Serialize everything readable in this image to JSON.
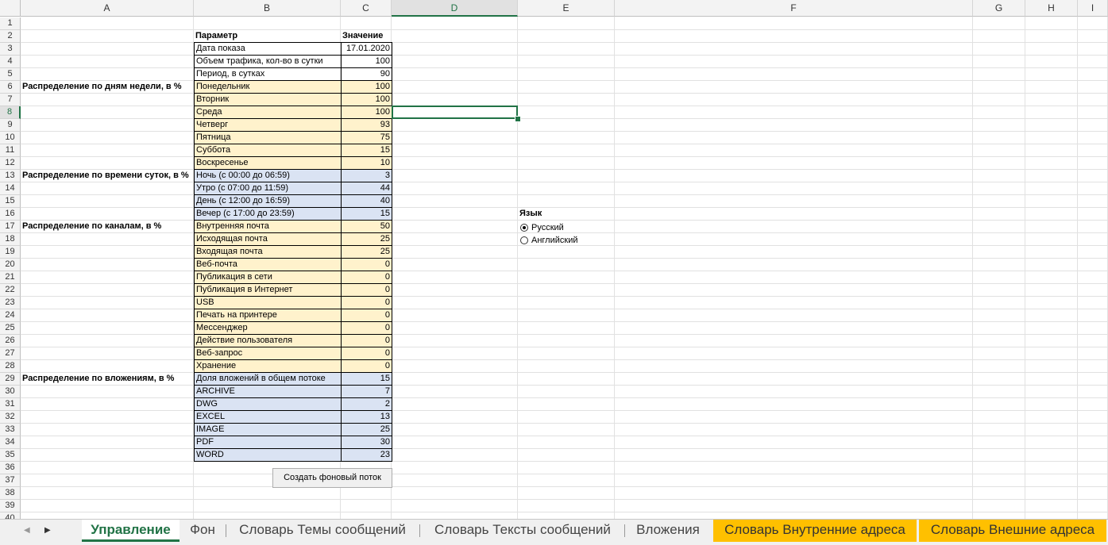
{
  "columns": [
    "A",
    "B",
    "C",
    "D",
    "E",
    "F",
    "G",
    "H",
    "I"
  ],
  "rows": [
    "1",
    "2",
    "3",
    "4",
    "5",
    "6",
    "7",
    "8",
    "9",
    "10",
    "11",
    "12",
    "13",
    "14",
    "15",
    "16",
    "17",
    "18",
    "19",
    "20",
    "21",
    "22",
    "23",
    "24",
    "25",
    "26",
    "27",
    "28",
    "29",
    "30",
    "31",
    "32",
    "33",
    "34",
    "35",
    "36",
    "37",
    "38",
    "39",
    "40"
  ],
  "header": {
    "param": "Параметр",
    "value": "Значение"
  },
  "table": [
    {
      "p": "Дата показа",
      "v": "17.01.2020",
      "fill": "none"
    },
    {
      "p": "Объем трафика, кол-во в сутки",
      "v": "100",
      "fill": "none"
    },
    {
      "p": "Период, в сутках",
      "v": "90",
      "fill": "none"
    },
    {
      "p": "Понедельник",
      "v": "100",
      "fill": "yellow"
    },
    {
      "p": "Вторник",
      "v": "100",
      "fill": "yellow"
    },
    {
      "p": "Среда",
      "v": "100",
      "fill": "yellow"
    },
    {
      "p": "Четверг",
      "v": "93",
      "fill": "yellow"
    },
    {
      "p": "Пятница",
      "v": "75",
      "fill": "yellow"
    },
    {
      "p": "Суббота",
      "v": "15",
      "fill": "yellow"
    },
    {
      "p": "Воскресенье",
      "v": "10",
      "fill": "yellow"
    },
    {
      "p": "Ночь (с 00:00 до 06:59)",
      "v": "3",
      "fill": "blue"
    },
    {
      "p": "Утро (с 07:00 до 11:59)",
      "v": "44",
      "fill": "blue"
    },
    {
      "p": "День (с 12:00 до 16:59)",
      "v": "40",
      "fill": "blue"
    },
    {
      "p": "Вечер (с 17:00 до 23:59)",
      "v": "15",
      "fill": "blue"
    },
    {
      "p": "Внутренняя почта",
      "v": "50",
      "fill": "yellow"
    },
    {
      "p": "Исходящая почта",
      "v": "25",
      "fill": "yellow"
    },
    {
      "p": "Входящая почта",
      "v": "25",
      "fill": "yellow"
    },
    {
      "p": "Веб-почта",
      "v": "0",
      "fill": "yellow"
    },
    {
      "p": "Публикация в сети",
      "v": "0",
      "fill": "yellow"
    },
    {
      "p": "Публикация в Интернет",
      "v": "0",
      "fill": "yellow"
    },
    {
      "p": "USB",
      "v": "0",
      "fill": "yellow"
    },
    {
      "p": "Печать на принтере",
      "v": "0",
      "fill": "yellow"
    },
    {
      "p": "Мессенджер",
      "v": "0",
      "fill": "yellow"
    },
    {
      "p": "Действие пользователя",
      "v": "0",
      "fill": "yellow"
    },
    {
      "p": "Веб-запрос",
      "v": "0",
      "fill": "yellow"
    },
    {
      "p": "Хранение",
      "v": "0",
      "fill": "yellow"
    },
    {
      "p": "Доля вложений в общем потоке",
      "v": "15",
      "fill": "blue"
    },
    {
      "p": "ARCHIVE",
      "v": "7",
      "fill": "blue"
    },
    {
      "p": "DWG",
      "v": "2",
      "fill": "blue"
    },
    {
      "p": "EXCEL",
      "v": "13",
      "fill": "blue"
    },
    {
      "p": "IMAGE",
      "v": "25",
      "fill": "blue"
    },
    {
      "p": "PDF",
      "v": "30",
      "fill": "blue"
    },
    {
      "p": "WORD",
      "v": "23",
      "fill": "blue"
    }
  ],
  "section_labels": {
    "days": "Распределение по дням недели, в %",
    "time": "Распределение по времени суток, в %",
    "channels": "Распределение по каналам, в %",
    "attachments": "Распределение по вложениям, в %"
  },
  "language": {
    "title": "Язык",
    "options": [
      "Русский",
      "Английский"
    ],
    "selected": "Русский"
  },
  "button_label": "Создать фоновый поток",
  "tabs": [
    "Управление",
    "Фон",
    "Словарь Темы сообщений",
    "Словарь Тексты сообщений",
    "Вложения",
    "Словарь Внутренние адреса",
    "Словарь Внешние адреса"
  ],
  "active_tab": "Управление",
  "colors": {
    "accent": "#217346",
    "yellow_fill": "#fff2cc",
    "blue_fill": "#dae3f3",
    "orange_tab": "#ffc000"
  }
}
